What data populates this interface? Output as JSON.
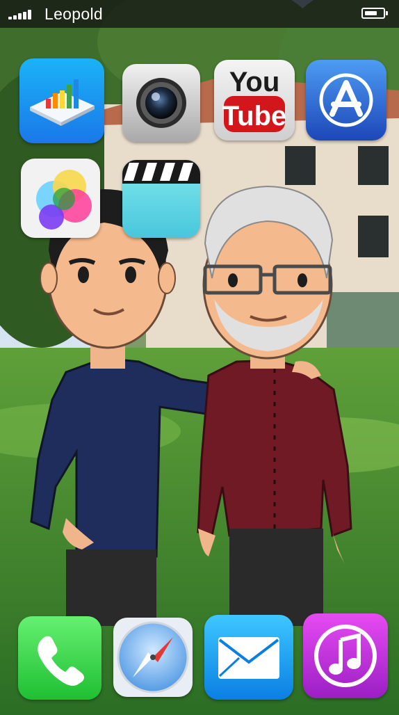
{
  "status_bar": {
    "carrier": "Leopold",
    "signal_bars": 5,
    "battery_level": 0.7
  },
  "home_screen": {
    "apps": [
      {
        "icon": "numbers-chart-icon"
      },
      {
        "icon": "camera-icon"
      },
      {
        "icon": "youtube-icon",
        "label_top": "You",
        "label_bottom": "Tube"
      },
      {
        "icon": "app-store-icon"
      },
      {
        "icon": "game-center-icon"
      },
      {
        "icon": "videos-clapper-icon"
      }
    ],
    "dock": [
      {
        "icon": "phone-icon"
      },
      {
        "icon": "safari-compass-icon"
      },
      {
        "icon": "mail-icon"
      },
      {
        "icon": "itunes-music-icon"
      }
    ]
  },
  "colors": {
    "status_bar_bg": "#141414",
    "phone_green": "#3ad84a",
    "mail_blue": "#1aa7f0",
    "itunes_purple": "#c22bd6",
    "youtube_red": "#d3161b",
    "app_store_blue": "#1d63d6"
  }
}
